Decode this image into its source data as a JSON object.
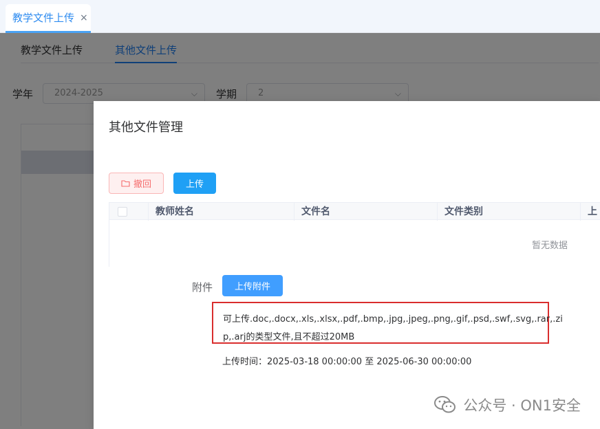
{
  "window": {
    "tab_title": "教学文件上传",
    "tab_close": "×"
  },
  "background": {
    "sub_tabs": [
      "教学文件上传",
      "其他文件上传"
    ],
    "active_sub_tab": 1,
    "filters": {
      "year_label": "学年",
      "year_value": "2024-2025",
      "term_label": "学期",
      "term_value": "2"
    }
  },
  "dialog": {
    "title": "其他文件管理",
    "revoke_button": "撤回",
    "upload_button": "上传",
    "table": {
      "columns": [
        "教师姓名",
        "文件名",
        "文件类别",
        "上传"
      ],
      "empty_text": "暂无数据"
    },
    "attachment": {
      "label": "附件",
      "button": "上传附件",
      "hint_line1": "可上传.doc,.docx,.xls,.xlsx,.pdf,.bmp,.jpg,.jpeg,.png,.gif,.psd,.swf,.svg,.rar,.zi",
      "hint_line2": "p,.arj的类型文件,且不超过20MB",
      "time_text": "上传时间：2025-03-18 00:00:00 至 2025-06-30 00:00:00"
    }
  },
  "watermark": {
    "text": "公众号 · ON1安全"
  },
  "colors": {
    "primary": "#1fa0f5",
    "danger": "#f56c6c",
    "highlight_border": "#d92d2d"
  }
}
